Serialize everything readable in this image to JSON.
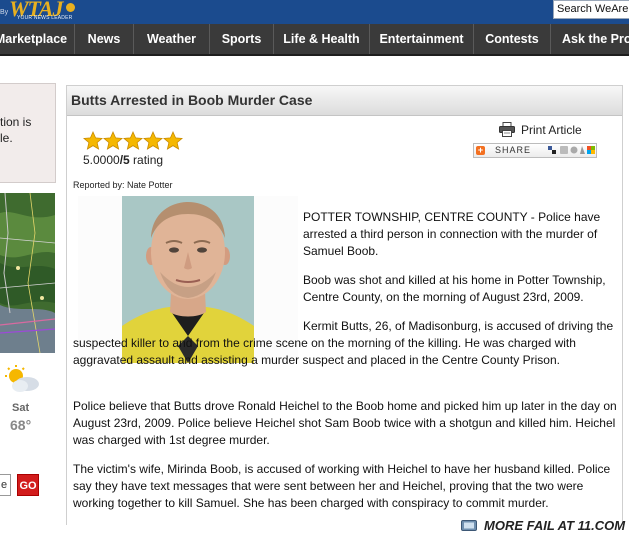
{
  "header": {
    "logo_prefix": "By",
    "logo": "WTAJ",
    "logo_tagline": "YOUR NEWS LEADER",
    "search_placeholder": "Search WeAre"
  },
  "nav": {
    "items": [
      {
        "label": "Marketplace"
      },
      {
        "label": "News"
      },
      {
        "label": "Weather"
      },
      {
        "label": "Sports"
      },
      {
        "label": "Life & Health"
      },
      {
        "label": "Entertainment"
      },
      {
        "label": "Contests"
      },
      {
        "label": "Ask the Pro"
      }
    ]
  },
  "sidebar": {
    "box_text_line1": "tion is",
    "box_text_line2": "le.",
    "weather_day": "Sat",
    "weather_temp": "68°",
    "zip_value": "e",
    "go_label": "GO"
  },
  "article": {
    "title": "Butts Arrested in Boob Murder Case",
    "rating_value": "5.0000",
    "rating_max": "/5",
    "rating_suffix": " rating",
    "rating_stars": 5,
    "print_label": "Print Article",
    "share_label": "SHARE",
    "byline": "Reported by: Nate Potter",
    "paragraphs": [
      "POTTER TOWNSHIP, CENTRE COUNTY - Police have arrested a third person in connection with the murder of Samuel Boob.",
      "Boob was shot and killed at his home in Potter Township, Centre County, on the morning of August 23rd, 2009.",
      "Kermit Butts, 26, of Madisonburg, is accused of driving the suspected killer to and from the crime scene on the morning of the killing.  He was charged with aggravated assault and assisting a murder suspect and placed in the Centre County Prison.",
      "Police believe that Butts drove Ronald Heichel to the Boob home and picked him up later in the day on August 23rd, 2009.  Police believe Heichel shot Sam Boob twice with a shotgun and killed him.  Heichel was charged with 1st degree murder.",
      "The victim's wife, Mirinda Boob, is accused of working with Heichel to have her husband killed.  Police say they have text messages that were sent between her and Heichel, proving that the two were working together to kill Samuel.  She has been charged with conspiracy to commit murder."
    ]
  },
  "footer": {
    "watermark": "MORE FAIL AT 11.COM"
  },
  "colors": {
    "nav_bg": "#3a3a3a",
    "header_bg": "#1b4b8e",
    "logo": "#e8b020",
    "go_button": "#d21c1c",
    "star": "#f5b800"
  }
}
